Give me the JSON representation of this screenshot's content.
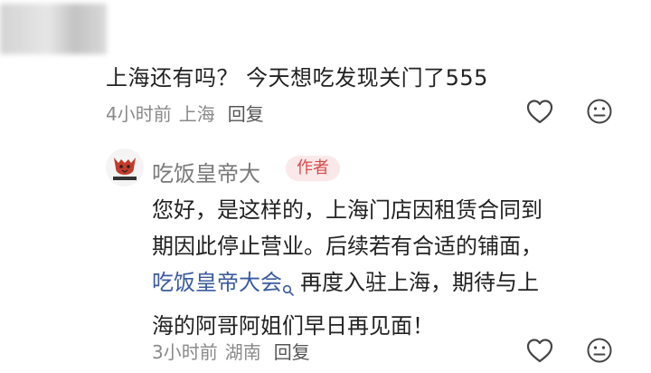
{
  "comment": {
    "text": "上海还有吗？ 今天想吃发现关门了555",
    "time": "4小时前",
    "location": "上海",
    "reply_label": "回复"
  },
  "reply": {
    "author_name": "吃饭皇帝大",
    "author_badge": "作者",
    "body": {
      "line1": "您好，是这样的，上海门店因租赁合同到",
      "line2": "期因此停止营业。后续若有合适的铺面，",
      "line3_link": "吃饭皇帝大会",
      "line3_rest": "再度入驻上海，期待与上",
      "line4": "海的阿哥阿姐们早日再见面！"
    },
    "time": "3小时前",
    "location": "湖南",
    "reply_label": "回复"
  },
  "icons": [
    "heart-outline-icon",
    "neutral-face-icon",
    "search-icon",
    "tiger-logo-avatar"
  ],
  "colors": {
    "text": "#222222",
    "meta": "#8a8a8a",
    "link": "#3b5b9d",
    "badge_bg": "#fbe9e9",
    "badge_text": "#d84a4a"
  }
}
